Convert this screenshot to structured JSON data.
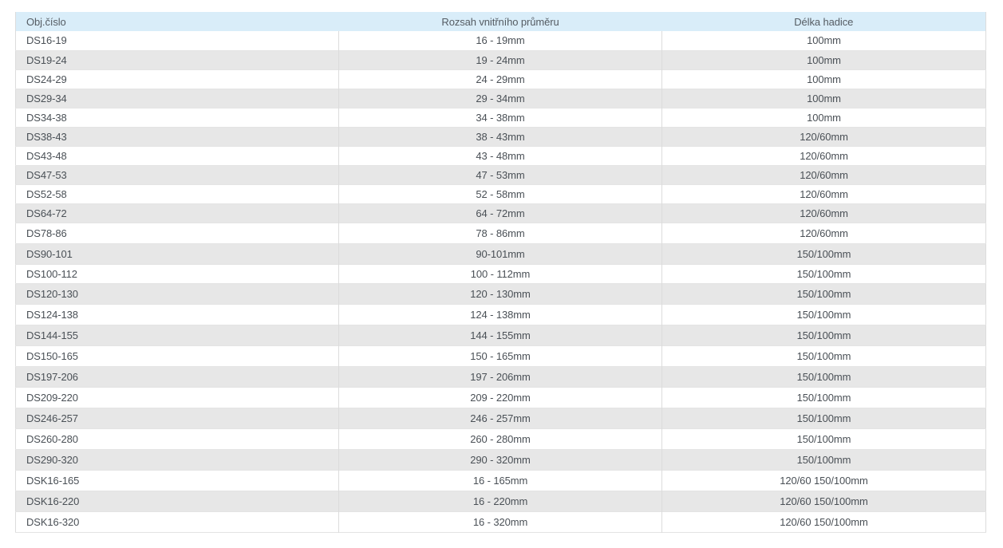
{
  "table": {
    "headers": [
      "Obj.číslo",
      "Rozsah vnitřního průměru",
      "Délka hadice"
    ],
    "rows": [
      [
        "DS16-19",
        "16 - 19mm",
        "100mm"
      ],
      [
        "DS19-24",
        "19 - 24mm",
        "100mm"
      ],
      [
        "DS24-29",
        "24 - 29mm",
        "100mm"
      ],
      [
        "DS29-34",
        "29 - 34mm",
        "100mm"
      ],
      [
        "DS34-38",
        "34 - 38mm",
        "100mm"
      ],
      [
        "DS38-43",
        "38 - 43mm",
        "120/60mm"
      ],
      [
        "DS43-48",
        "43 - 48mm",
        "120/60mm"
      ],
      [
        "DS47-53",
        "47 - 53mm",
        "120/60mm"
      ],
      [
        "DS52-58",
        "52 - 58mm",
        "120/60mm"
      ],
      [
        "DS64-72",
        "64 - 72mm",
        "120/60mm"
      ],
      [
        "DS78-86",
        "78 - 86mm",
        "120/60mm"
      ],
      [
        "DS90-101",
        "90-101mm",
        "150/100mm"
      ],
      [
        "DS100-112",
        "100 - 112mm",
        "150/100mm"
      ],
      [
        "DS120-130",
        "120 - 130mm",
        "150/100mm"
      ],
      [
        "DS124-138",
        "124 - 138mm",
        "150/100mm"
      ],
      [
        "DS144-155",
        "144 - 155mm",
        "150/100mm"
      ],
      [
        "DS150-165",
        "150 - 165mm",
        "150/100mm"
      ],
      [
        "DS197-206",
        "197 - 206mm",
        "150/100mm"
      ],
      [
        "DS209-220",
        "209 - 220mm",
        "150/100mm"
      ],
      [
        "DS246-257",
        "246 - 257mm",
        "150/100mm"
      ],
      [
        "DS260-280",
        "260 - 280mm",
        "150/100mm"
      ],
      [
        "DS290-320",
        "290 - 320mm",
        "150/100mm"
      ],
      [
        "DSK16-165",
        "16 - 165mm",
        "120/60 150/100mm"
      ],
      [
        "DSK16-220",
        "16 - 220mm",
        "120/60 150/100mm"
      ],
      [
        "DSK16-320",
        "16 - 320mm",
        "120/60 150/100mm"
      ]
    ]
  },
  "colors": {
    "header_bg": "#d9edf9",
    "row_alt_bg": "#e7e7e7",
    "text": "#4a5056"
  }
}
